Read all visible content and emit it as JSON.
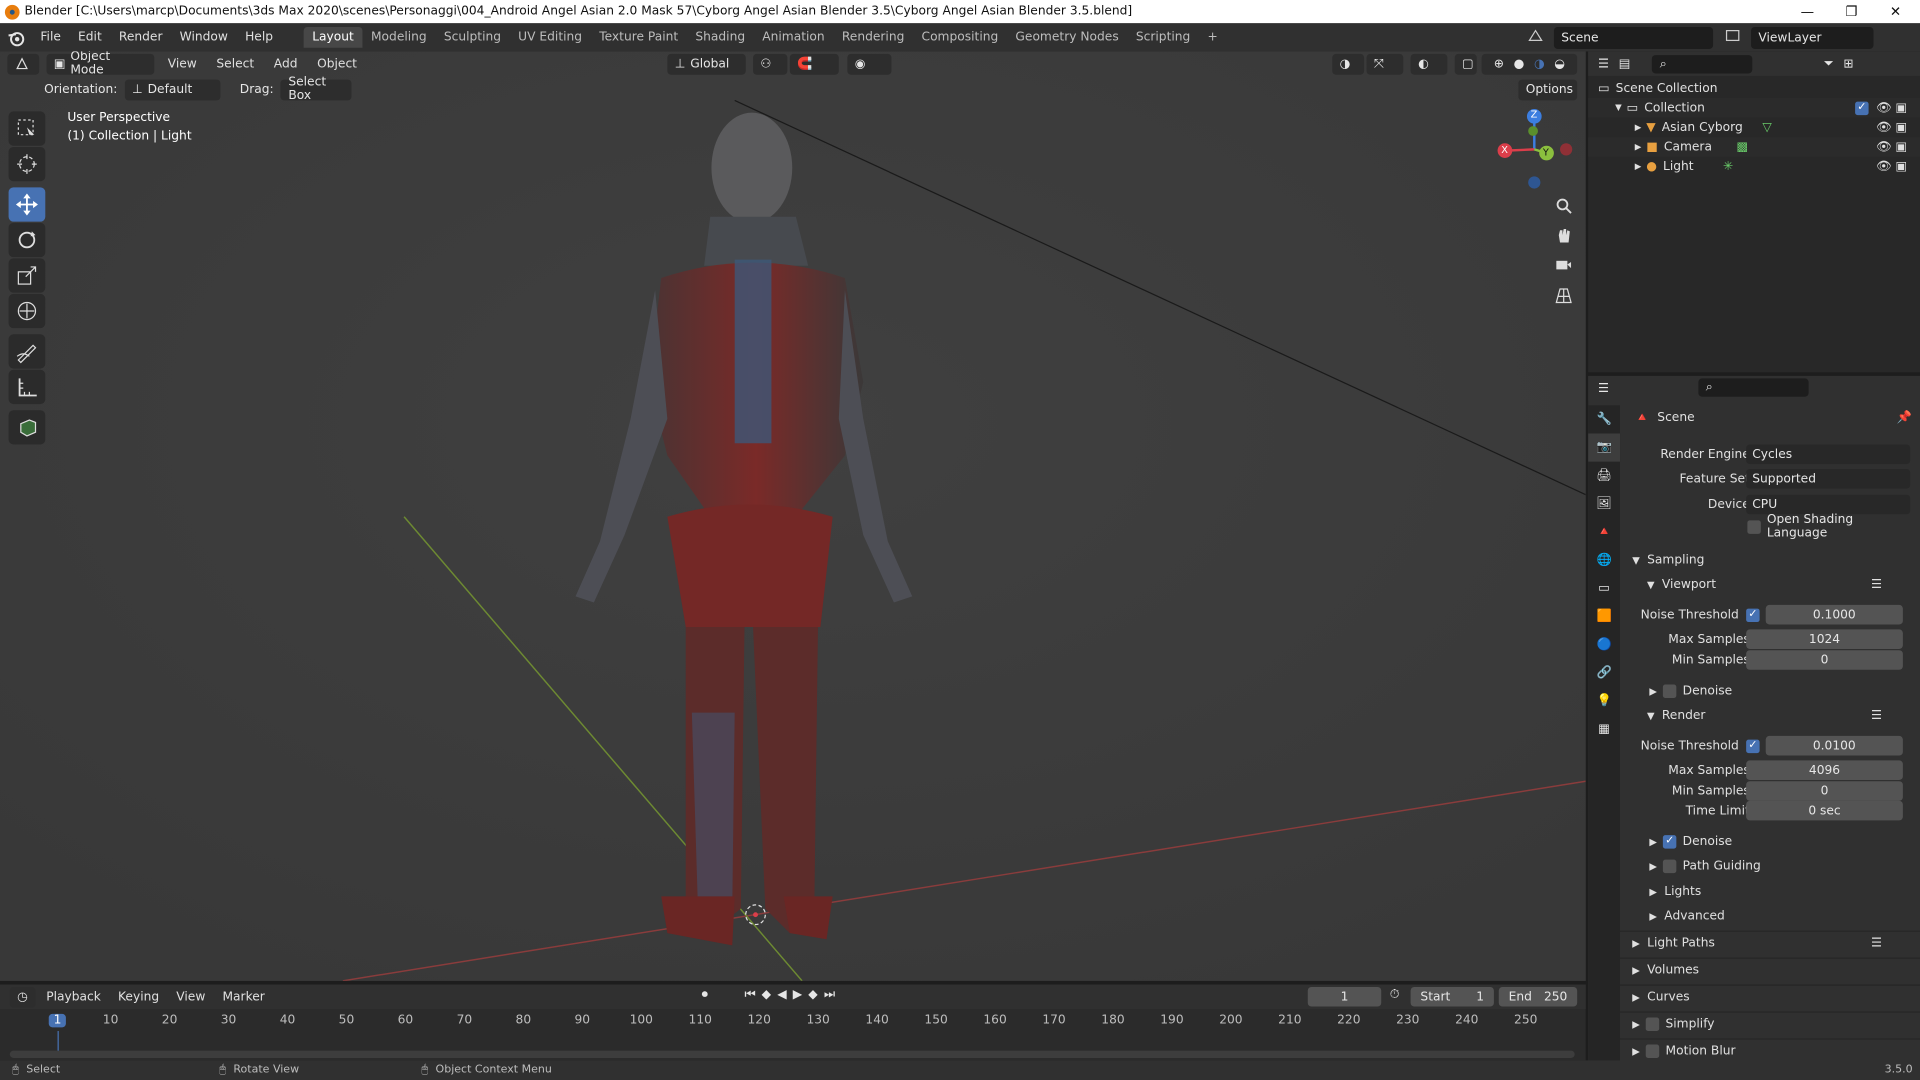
{
  "window": {
    "title": "Blender [C:\\Users\\marcp\\Documents\\3ds Max 2020\\scenes\\Personaggi\\004_Android Angel Asian 2.0 Mask 57\\Cyborg Angel Asian Blender 3.5\\Cyborg Angel Asian Blender 3.5.blend]",
    "min": "—",
    "max": "❐",
    "close": "✕"
  },
  "menu": [
    "File",
    "Edit",
    "Render",
    "Window",
    "Help"
  ],
  "workspaces": [
    "Layout",
    "Modeling",
    "Sculpting",
    "UV Editing",
    "Texture Paint",
    "Shading",
    "Animation",
    "Rendering",
    "Compositing",
    "Geometry Nodes",
    "Scripting"
  ],
  "add_workspace": "+",
  "scene": "Scene",
  "view_layer": "ViewLayer",
  "viewport": {
    "mode": "Object Mode",
    "menus": [
      "View",
      "Select",
      "Add",
      "Object"
    ],
    "transform": "Global",
    "orientation_label": "Orientation:",
    "orientation": "Default",
    "drag_label": "Drag:",
    "drag": "Select Box",
    "options": "Options",
    "overlay_line1": "User Perspective",
    "overlay_line2": "(1) Collection | Light",
    "gizmo": {
      "x": "X",
      "y": "Y",
      "z": "Z"
    }
  },
  "outliner": {
    "root": "Scene Collection",
    "collection": "Collection",
    "items": [
      "Asian Cyborg",
      "Camera",
      "Light"
    ]
  },
  "properties": {
    "scene": "Scene",
    "render_engine_label": "Render Engine",
    "render_engine": "Cycles",
    "feature_set_label": "Feature Set",
    "feature_set": "Supported",
    "device_label": "Device",
    "device": "CPU",
    "osl": "Open Shading Language",
    "sampling": "Sampling",
    "viewport": "Viewport",
    "noise_threshold_label": "Noise Threshold",
    "vp_noise": "0.1000",
    "max_samples_label": "Max Samples",
    "vp_max": "1024",
    "min_samples_label": "Min Samples",
    "vp_min": "0",
    "denoise": "Denoise",
    "render": "Render",
    "r_noise": "0.0100",
    "r_max": "4096",
    "r_min": "0",
    "time_limit_label": "Time Limit",
    "time_limit": "0 sec",
    "path_guiding": "Path Guiding",
    "lights": "Lights",
    "advanced": "Advanced",
    "light_paths": "Light Paths",
    "volumes": "Volumes",
    "curves": "Curves",
    "simplify": "Simplify",
    "motion_blur": "Motion Blur"
  },
  "timeline": {
    "menus": [
      "Playback",
      "Keying",
      "View",
      "Marker"
    ],
    "current_frame": "1",
    "start_label": "Start",
    "start": "1",
    "end_label": "End",
    "end": "250",
    "ticks": [
      "1",
      "10",
      "20",
      "30",
      "40",
      "50",
      "60",
      "70",
      "80",
      "90",
      "100",
      "110",
      "120",
      "130",
      "140",
      "150",
      "160",
      "170",
      "180",
      "190",
      "200",
      "210",
      "220",
      "230",
      "240",
      "250"
    ]
  },
  "status": {
    "select": "Select",
    "rotate": "Rotate View",
    "context": "Object Context Menu",
    "version": "3.5.0"
  },
  "colors": {
    "accent": "#4772b3",
    "x_axis": "#db3e4a",
    "y_axis": "#8bbf3e",
    "z_axis": "#3c7ee0"
  }
}
